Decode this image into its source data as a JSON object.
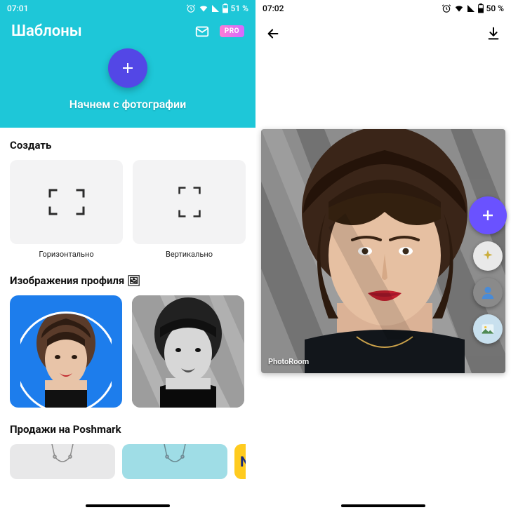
{
  "left": {
    "status": {
      "time": "07:01",
      "battery": "51 %"
    },
    "header": {
      "title": "Шаблоны",
      "pro_label": "PRO",
      "subtitle": "Начнем с фотографии"
    },
    "sections": {
      "create": {
        "title": "Создать",
        "horizontal_label": "Горизонтально",
        "vertical_label": "Вертикально"
      },
      "profile": {
        "title": "Изображения профиля 🖼"
      },
      "poshmark": {
        "title": "Продажи на Poshmark",
        "peek_letter": "N"
      }
    }
  },
  "right": {
    "status": {
      "time": "07:02",
      "battery": "50 %"
    },
    "watermark": "PhotoRoom"
  }
}
